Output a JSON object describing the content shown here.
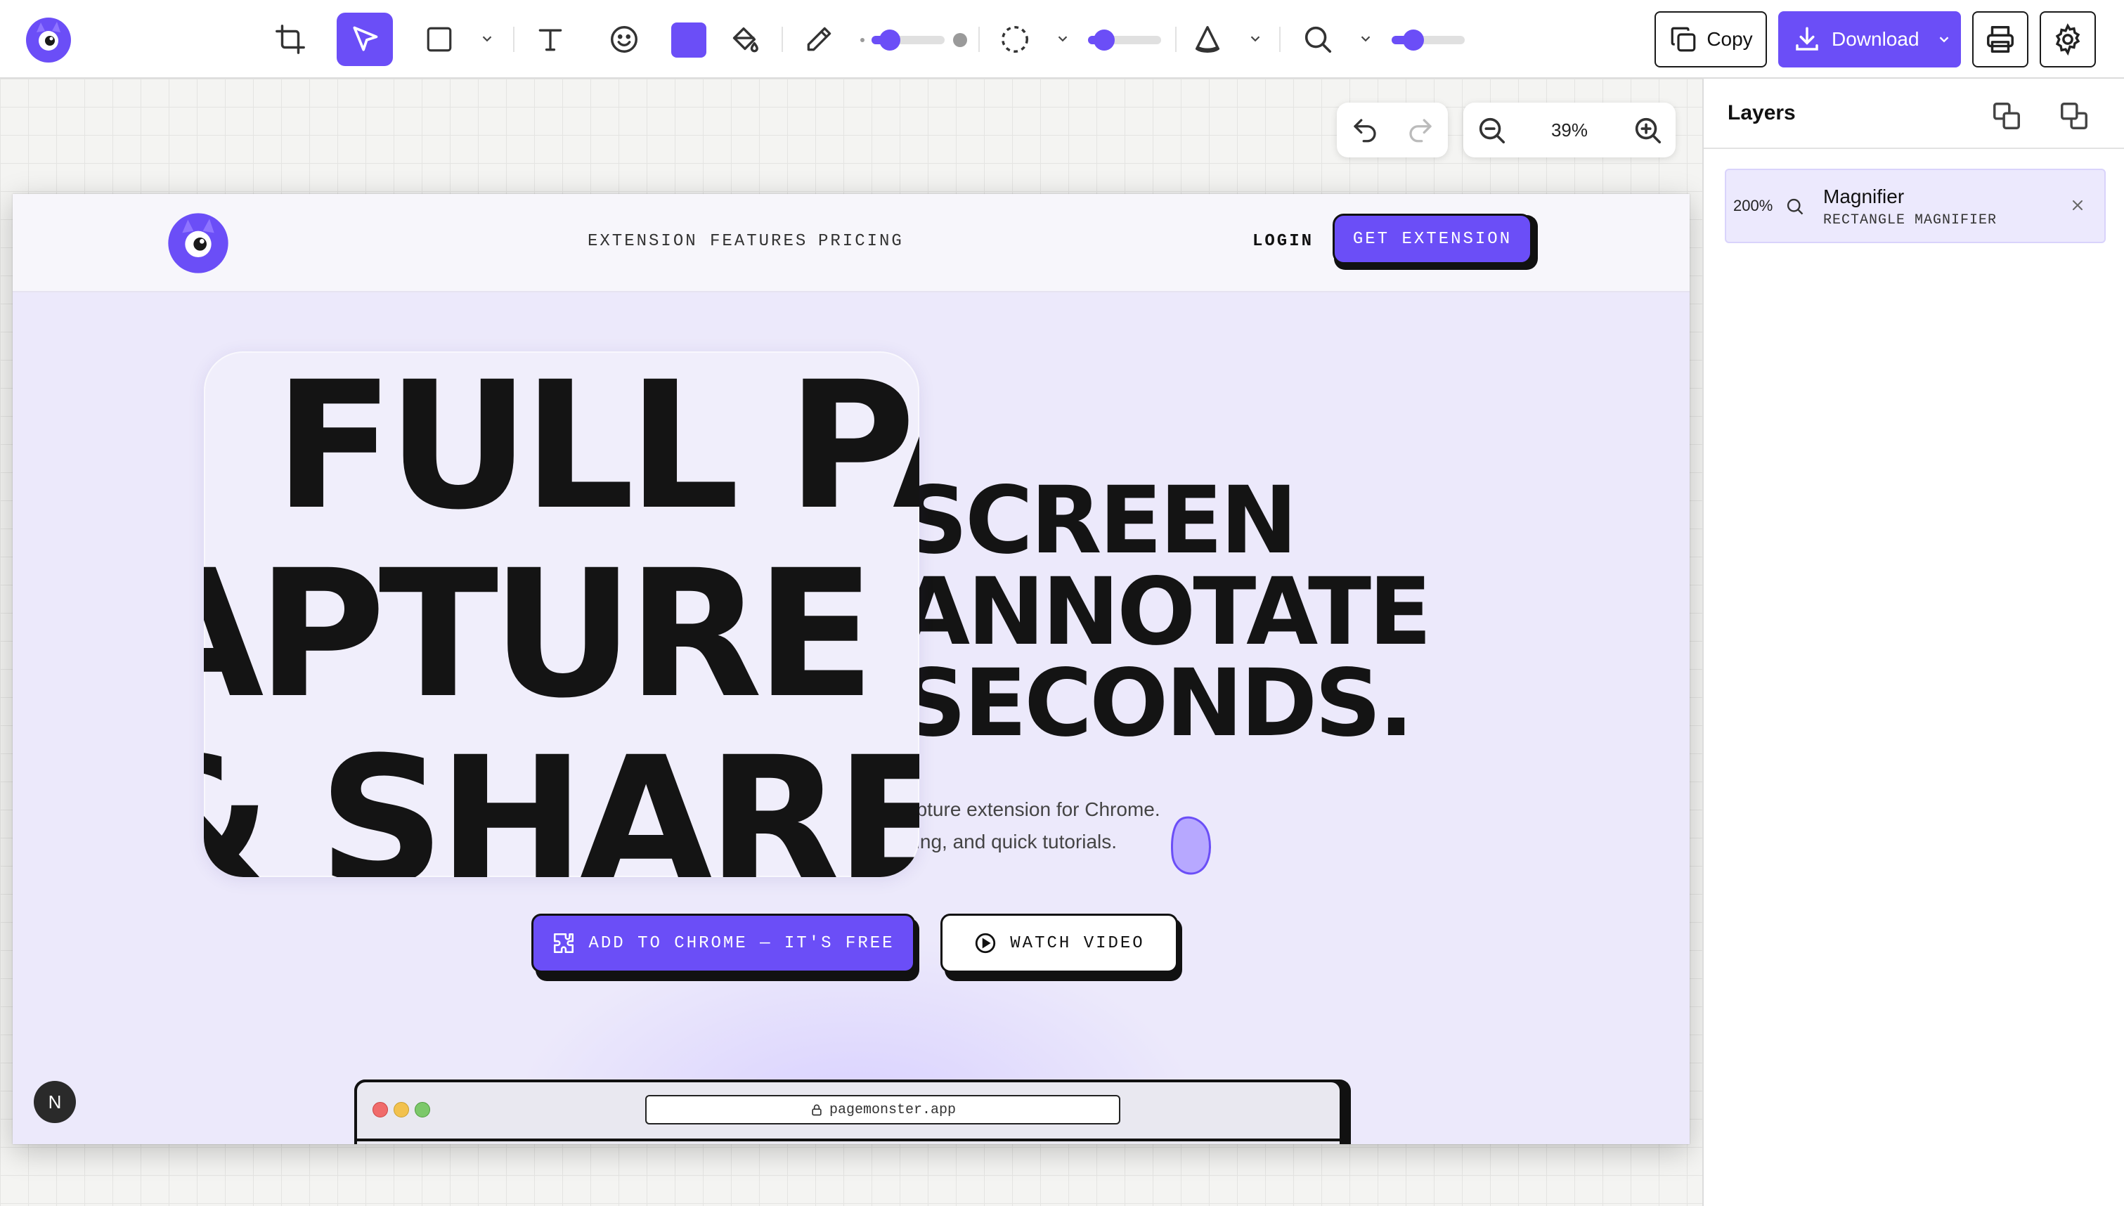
{
  "toolbar": {
    "tools": [
      {
        "name": "crop-icon"
      },
      {
        "name": "select-arrow-icon",
        "active": true
      },
      {
        "name": "rectangle-icon"
      },
      {
        "name": "text-icon"
      },
      {
        "name": "emoji-icon"
      },
      {
        "name": "fill-bucket-icon"
      },
      {
        "name": "pencil-icon"
      },
      {
        "name": "lasso-selection-icon"
      },
      {
        "name": "blur-cone-icon"
      },
      {
        "name": "magnifier-search-icon"
      }
    ],
    "active_color": "#6b4ef7",
    "stroke_width_level": 0.25,
    "selection_slider_level": 0.22,
    "magnifier_slider_level": 0.3,
    "copy_label": "Copy",
    "download_label": "Download"
  },
  "canvas": {
    "zoom_label": "39%"
  },
  "screenshot": {
    "nav": {
      "links": [
        "EXTENSION FEATURES",
        "PRICING"
      ],
      "login": "LOGIN",
      "get_extension": "GET EXTENSION"
    },
    "headline_lines": [
      "SCREEN",
      "ANNOTATE",
      "SECONDS."
    ],
    "subtitle_lines": [
      "apture extension for Chrome.",
      "orting, and quick tutorials."
    ],
    "cta_primary": "ADD TO CHROME — IT'S FREE",
    "cta_secondary": "WATCH VIDEO",
    "browser_url": "pagemonster.app",
    "magnified_lines": [
      "FULL PA",
      "APTURE",
      "& SHARE"
    ],
    "corner_badge": "N"
  },
  "layers_panel": {
    "title": "Layers",
    "items": [
      {
        "zoom": "200%",
        "name": "Magnifier",
        "type": "RECTANGLE MAGNIFIER"
      }
    ]
  },
  "colors": {
    "accent": "#6b4ef7",
    "ink": "#141414",
    "hero_bg": "#ece9fb"
  }
}
